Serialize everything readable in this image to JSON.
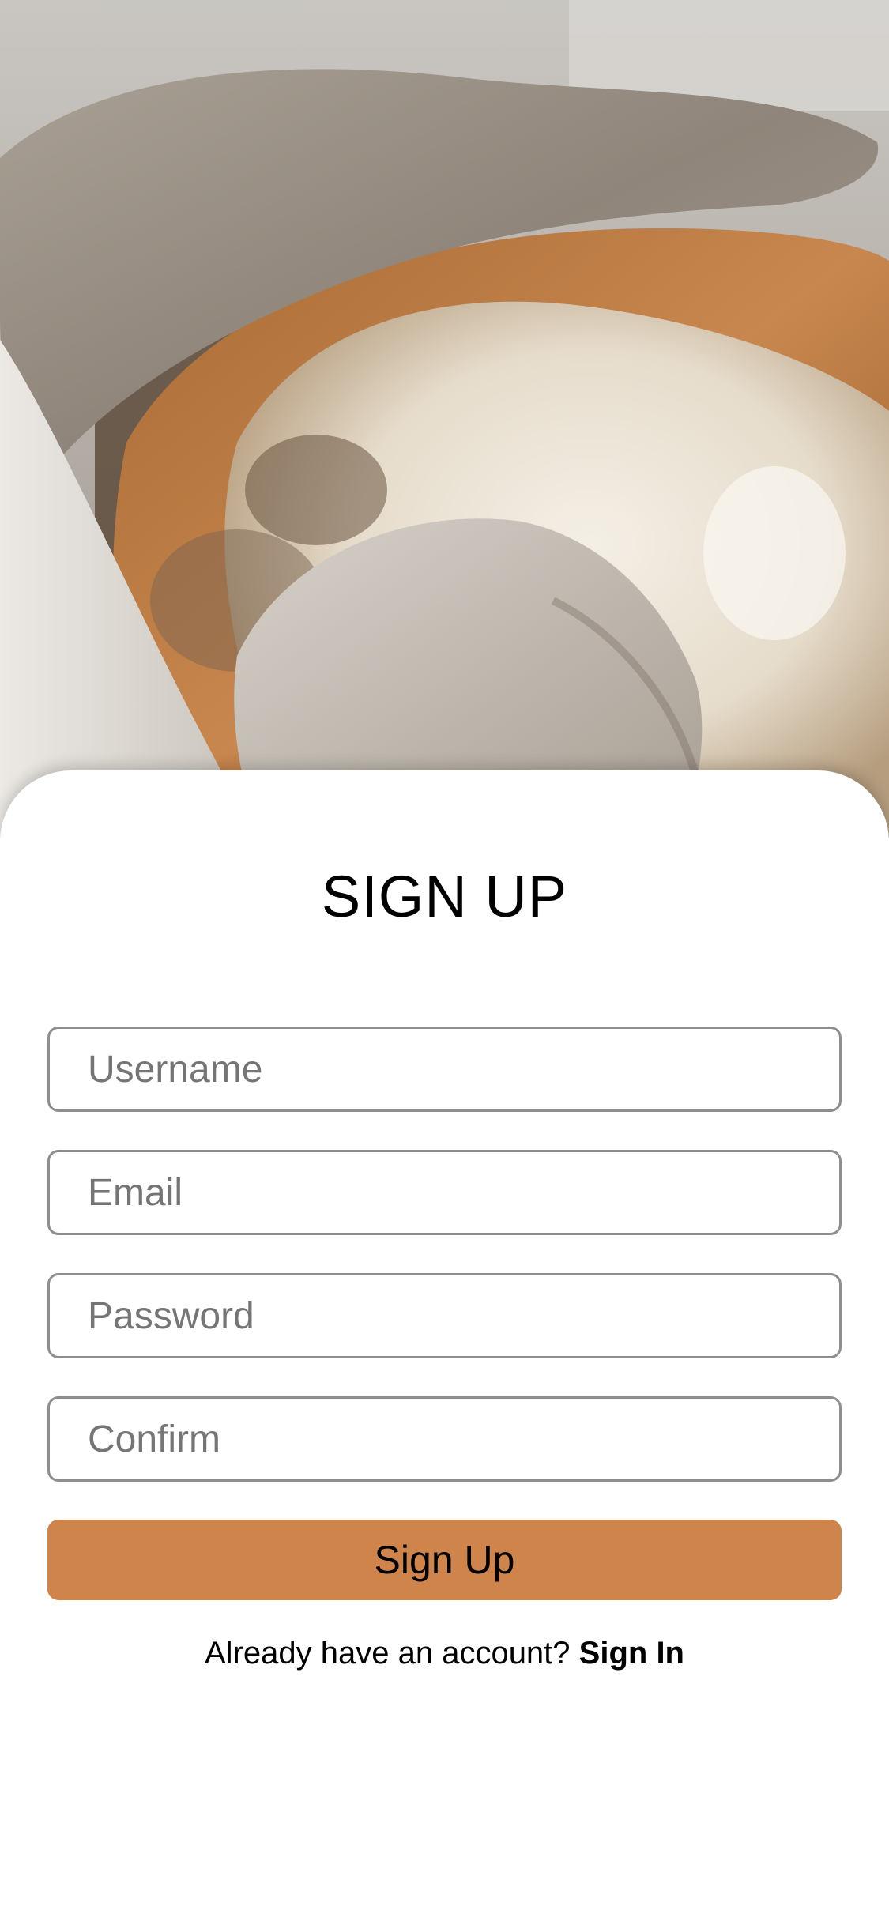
{
  "hero": {
    "image": "bread-loaf-in-linen-cloth-photo"
  },
  "form": {
    "title": "SIGN UP",
    "fields": {
      "username": {
        "placeholder": "Username",
        "value": ""
      },
      "email": {
        "placeholder": "Email",
        "value": ""
      },
      "password": {
        "placeholder": "Password",
        "value": ""
      },
      "confirm": {
        "placeholder": "Confirm",
        "value": ""
      }
    },
    "submit_label": "Sign Up"
  },
  "footer": {
    "prompt": "Already have an account?",
    "link_label": "Sign In"
  },
  "colors": {
    "accent": "#ce844a",
    "field_border": "#8e8e8e",
    "placeholder": "#757575",
    "background": "#ffffff"
  }
}
